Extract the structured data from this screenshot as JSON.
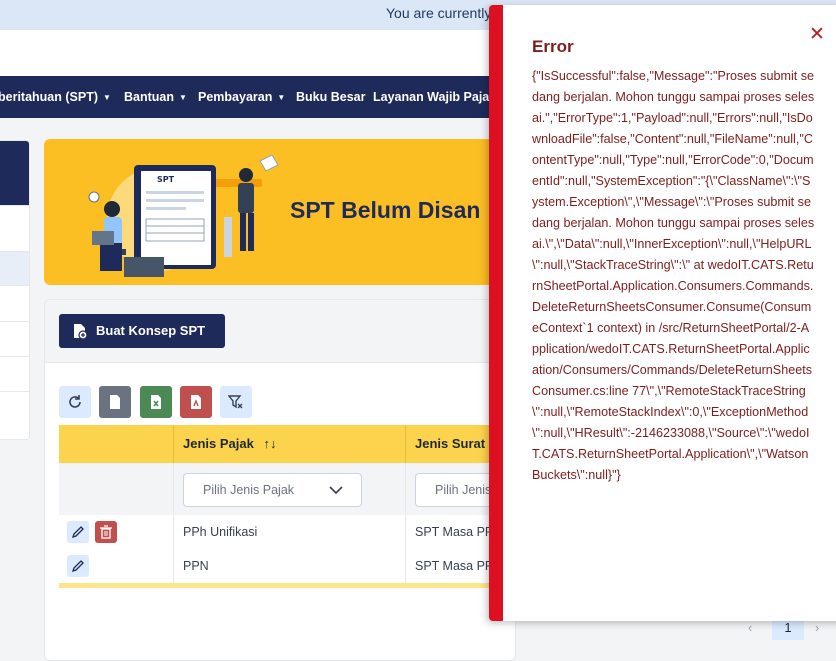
{
  "banner": {
    "text": "You are currently"
  },
  "nav": {
    "items": [
      {
        "label": "beritahuan (SPT)",
        "dropdown": true
      },
      {
        "label": "Bantuan",
        "dropdown": true
      },
      {
        "label": "Pembayaran",
        "dropdown": true
      },
      {
        "label": "Buku Besar",
        "dropdown": false
      },
      {
        "label": "Layanan Wajib Pajak",
        "dropdown": false
      }
    ]
  },
  "hero": {
    "title": "SPT Belum Disan",
    "illustration_label": "SPT"
  },
  "toolbar": {
    "create_label": "Buat Konsep SPT",
    "buttons": [
      {
        "icon": "refresh-icon",
        "color": "#dbeafe"
      },
      {
        "icon": "document-icon",
        "color": "#6b7280"
      },
      {
        "icon": "excel-icon",
        "color": "#4b8a54"
      },
      {
        "icon": "pdf-icon",
        "color": "#c0504d"
      },
      {
        "icon": "filter-clear-icon",
        "color": "#dbeafe"
      }
    ]
  },
  "table": {
    "columns": [
      {
        "label": ""
      },
      {
        "label": "Jenis Pajak",
        "sort_icon": "↑↓"
      },
      {
        "label": "Jenis Surat"
      }
    ],
    "filters": {
      "jenis_pajak_placeholder": "Pilih Jenis Pajak",
      "jenis_surat_placeholder": "Pilih Jenis"
    },
    "rows": [
      {
        "jenis_pajak": "PPh Unifikasi",
        "jenis_surat": "SPT Masa PP",
        "can_delete": true
      },
      {
        "jenis_pajak": "PPN",
        "jenis_surat": "SPT Masa PP",
        "can_delete": false
      }
    ]
  },
  "modal": {
    "title": "Error",
    "close_icon": "close-icon",
    "message": "{\"IsSuccessful\":false,\"Message\":\"Proses submit sedang berjalan. Mohon tunggu sampai proses selesai.\",\"ErrorType\":1,\"Payload\":null,\"Errors\":null,\"IsDownloadFile\":false,\"Content\":null,\"FileName\":null,\"ContentType\":null,\"Type\":null,\"ErrorCode\":0,\"DocumentId\":null,\"SystemException\":\"{\\\"ClassName\\\":\\\"System.Exception\\\",\\\"Message\\\":\\\"Proses submit sedang berjalan. Mohon tunggu sampai proses selesai.\\\",\\\"Data\\\":null,\\\"InnerException\\\":null,\\\"HelpURL\\\":null,\\\"StackTraceString\\\":\\\" at wedoIT.CATS.ReturnSheetPortal.Application.Consumers.Commands.DeleteReturnSheetsConsumer.Consume(ConsumeContext`1 context) in /src/ReturnSheetPortal/2-Application/wedoIT.CATS.ReturnSheetPortal.Application/Consumers/Commands/DeleteReturnSheetsConsumer.cs:line 77\\\",\\\"RemoteStackTraceString\\\":null,\\\"RemoteStackIndex\\\":0,\\\"ExceptionMethod\\\":null,\\\"HResult\\\":-2146233088,\\\"Source\\\":\\\"wedoIT.CATS.ReturnSheetPortal.Application\\\",\\\"WatsonBuckets\\\":null}\"}",
    "accent_color": "#dc0f23"
  },
  "pagination": {
    "current_page": "1",
    "prev": "‹",
    "next": "›"
  }
}
